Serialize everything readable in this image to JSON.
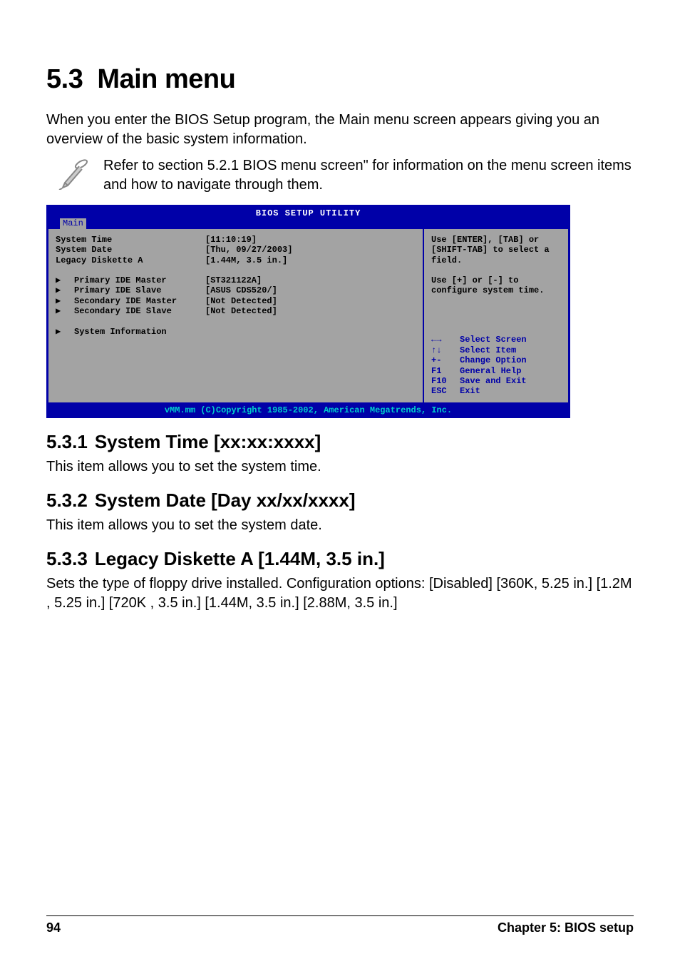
{
  "section": {
    "number": "5.3",
    "title": "Main menu"
  },
  "intro": "When you enter the BIOS Setup program, the Main menu screen appears giving you an overview of the basic system information.",
  "note": "Refer to section 5.2.1 BIOS menu screen\" for information on the menu screen items and how to navigate through them.",
  "bios": {
    "title": "BIOS SETUP UTILITY",
    "tab": "Main",
    "rows": {
      "system_time_label": "System Time",
      "system_time_value": "[11:10:19]",
      "system_date_label": "System Date",
      "system_date_value": "[Thu, 09/27/2003]",
      "diskette_label": "Legacy Diskette A",
      "diskette_value": "[1.44M, 3.5 in.]"
    },
    "subitems": [
      {
        "label": "Primary IDE Master",
        "value": "[ST321122A]"
      },
      {
        "label": "Primary IDE Slave",
        "value": "[ASUS CDS520/]"
      },
      {
        "label": "Secondary IDE Master",
        "value": "[Not Detected]"
      },
      {
        "label": "Secondary IDE Slave",
        "value": "[Not Detected]"
      }
    ],
    "sysinfo": "System Information",
    "help_top": "Use [ENTER], [TAB] or [SHIFT-TAB] to select a field.",
    "help_bottom": "Use [+] or [-] to configure system time.",
    "keys": [
      {
        "k": "←→",
        "v": "Select Screen"
      },
      {
        "k": "↑↓",
        "v": "Select Item"
      },
      {
        "k": "+-",
        "v": "Change Option"
      },
      {
        "k": "F1",
        "v": "General Help"
      },
      {
        "k": "F10",
        "v": "Save and Exit"
      },
      {
        "k": "ESC",
        "v": "Exit"
      }
    ],
    "copyright": "vMM.mm (C)Copyright 1985-2002, American Megatrends, Inc."
  },
  "subs": {
    "s1": {
      "num": "5.3.1",
      "title": "System Time [xx:xx:xxxx]",
      "body": "This item allows you to set the system time."
    },
    "s2": {
      "num": "5.3.2",
      "title": "System Date [Day xx/xx/xxxx]",
      "body": "This item allows you to set the system date."
    },
    "s3": {
      "num": "5.3.3",
      "title": "Legacy Diskette A [1.44M, 3.5 in.]",
      "body": "Sets the type of floppy drive installed. Configuration options: [Disabled] [360K, 5.25 in.] [1.2M , 5.25 in.] [720K , 3.5 in.] [1.44M, 3.5 in.] [2.88M, 3.5 in.]"
    }
  },
  "footer": {
    "page": "94",
    "chapter": "Chapter 5: BIOS setup"
  }
}
